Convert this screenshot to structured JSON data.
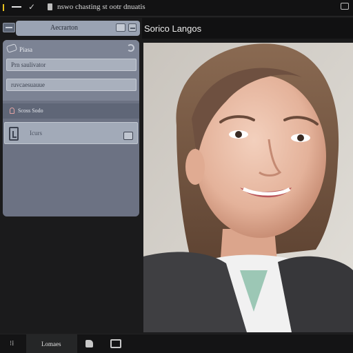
{
  "window": {
    "title": "nswo chasting st ootr dnuatis"
  },
  "toolbar": {
    "tab_label": "Aecrarton"
  },
  "viewer": {
    "title": "Sorico Langos",
    "photo_alt": "portrait photo"
  },
  "settings": {
    "header_label": "Piasa",
    "fields": [
      {
        "value": "Prn saulivator"
      },
      {
        "value": "ruvcaesuauue"
      }
    ],
    "section_label": "Scoss Sodo",
    "item_label": "Icurs"
  },
  "bottom": {
    "tab_label": "Lomaes"
  },
  "colors": {
    "accent": "#e8c21e",
    "panel": "#6c7283",
    "field": "#a9b0bd"
  }
}
